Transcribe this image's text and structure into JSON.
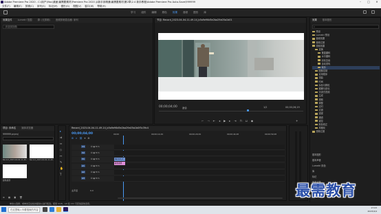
{
  "window": {
    "title": "Adobe Premiere Pro 2020 - C:\\用户\\Mac\\桌面\\最需要素材\\Premiere Pro 2020 从新手到精通\\最需要素材\\第2章\\2.4 新手教程\\Adobe Premiere Pro Auto-Save\\999999"
  },
  "menu": [
    "文件(F)",
    "编辑(E)",
    "剪辑(C)",
    "序列(S)",
    "标记(M)",
    "图形(G)",
    "视图(V)",
    "窗口(W)",
    "帮助(H)"
  ],
  "workspaces": {
    "tabs": [
      "学习",
      "组件",
      "编辑",
      "颜色",
      "效果",
      "音频",
      "图形",
      "库"
    ],
    "active_index": 4
  },
  "source_panel": {
    "tabs": [
      "效果控件",
      "Lumetri 范围",
      "源: (无剪辑)",
      "音频剪辑混合器: 序列"
    ],
    "active_index": 0,
    "placeholder": "(未选择剪辑)"
  },
  "program_monitor": {
    "tab": "节目: Record_2023-04-04-11-49-14_b5a9e96d5e2ba29a05a1b01",
    "timecode_left": "00;00;04;00",
    "fit_label": "适合",
    "quality_label": "1/2",
    "timecode_right": "00;00;26;19"
  },
  "project_panel": {
    "tabs": [
      "项目: 未命名",
      "媒体浏览器"
    ],
    "project_name": "999999.prproj",
    "items": [
      {
        "name": "Record_2023-04-04-11-49-14_...",
        "duration": "26;19"
      },
      {
        "name": "Record_2023-04-04-11-49-14_...",
        "duration": "26;19"
      },
      {
        "name": "颜色遮罩",
        "duration": ""
      }
    ]
  },
  "timeline": {
    "tab": "Record_2023-04-04-11-49-14_b5a9e96d5e2ba29a05a1b0f5c39c4",
    "timecode": "00;00;04;00",
    "ruler": [
      "00;00",
      "00;00;14;29",
      "00;00;29;29",
      "00;00;44;28",
      "00;00;59;28"
    ],
    "video_tracks": [
      "V3",
      "V2",
      "V1"
    ],
    "audio_tracks": [
      "A1",
      "A2",
      "A3"
    ],
    "master_label": "主声道",
    "master_value": "0.0",
    "clip_label": "Record_2",
    "mask_label": "颜色遮罩"
  },
  "effects_panel": {
    "tabs": [
      "效果",
      "基本图形"
    ],
    "search": "",
    "tree": [
      {
        "label": "预设",
        "level": 1
      },
      {
        "label": "Lumetri 预设",
        "level": 1
      },
      {
        "label": "音频效果",
        "level": 1
      },
      {
        "label": "音频过渡",
        "level": 1
      },
      {
        "label": "视频效果",
        "level": 1
      },
      {
        "label": "变换",
        "level": 2
      },
      {
        "label": "垂直翻转",
        "level": 3
      },
      {
        "label": "水平翻转",
        "level": 3
      },
      {
        "label": "羽化边缘",
        "level": 3
      },
      {
        "label": "自动重构",
        "level": 3
      },
      {
        "label": "裁剪",
        "level": 3
      },
      {
        "label": "图像控制",
        "level": 2
      },
      {
        "label": "实用程序",
        "level": 2
      },
      {
        "label": "扭曲",
        "level": 2
      },
      {
        "label": "时间",
        "level": 2
      },
      {
        "label": "杂色与颗粒",
        "level": 2
      },
      {
        "label": "模糊与锐化",
        "level": 2
      },
      {
        "label": "沉浸式视频",
        "level": 2
      },
      {
        "label": "生成",
        "level": 2
      },
      {
        "label": "视频",
        "level": 2
      },
      {
        "label": "调整",
        "level": 2
      },
      {
        "label": "过时",
        "level": 2
      },
      {
        "label": "过渡",
        "level": 2
      },
      {
        "label": "透视",
        "level": 2
      },
      {
        "label": "通道",
        "level": 2
      },
      {
        "label": "键控",
        "level": 2
      },
      {
        "label": "颜色校正",
        "level": 2
      },
      {
        "label": "风格化",
        "level": 2
      },
      {
        "label": "视频过渡",
        "level": 1
      }
    ],
    "footer": [
      "基本图形",
      "基本声音",
      "Lumetri 颜色",
      "库",
      "标记",
      "历史记录",
      "信息"
    ]
  },
  "status_bar": "单击以选择，或单击空白处并拖动以进行框选。使用 Shift、Alt 和 Ctrl 可获得其他选项。",
  "taskbar": {
    "search_placeholder": "在这里输入你要搜索的内容",
    "time": "17:03",
    "date": "2023/4/4"
  },
  "watermark": "最需教育"
}
